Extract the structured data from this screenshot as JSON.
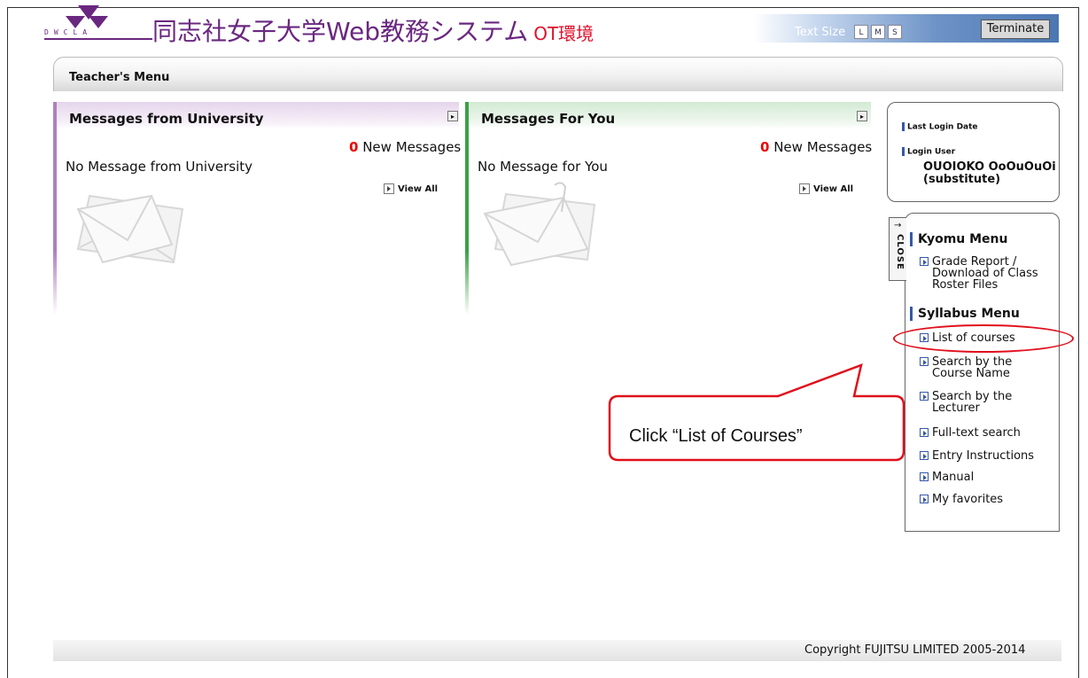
{
  "header": {
    "logo_letters": "DWCLA",
    "site_title": "同志社女子大学Web教務システム",
    "env_label": "OT環境",
    "text_size_label": "Text Size",
    "text_size_options": [
      "L",
      "M",
      "S"
    ],
    "terminate_label": "Terminate"
  },
  "menubar": {
    "label": "Teacher's Menu"
  },
  "panels": [
    {
      "title": "Messages from University",
      "new_count": "0",
      "new_label": " New Messages",
      "empty_text": "No Message from University",
      "view_all": "View All",
      "accent": "#b07fc0"
    },
    {
      "title": "Messages For You",
      "new_count": "0",
      "new_label": " New Messages",
      "empty_text": "No Message for You",
      "view_all": "View All",
      "accent": "#3aa148"
    }
  ],
  "login": {
    "last_login_label": "Last Login Date",
    "login_user_label": "Login User",
    "user_name": "OUOIOKO OoOuOuOi",
    "user_role": "(substitute)"
  },
  "sidebar": {
    "close_label": "CLOSE",
    "close_arrow": "→",
    "sections": [
      {
        "title": "Kyomu Menu",
        "items": [
          "Grade Report / Download of Class Roster Files"
        ]
      },
      {
        "title": "Syllabus Menu",
        "items": [
          "List of courses",
          "Search by the Course Name",
          "Search by the Lecturer",
          "Full-text search",
          "Entry Instructions",
          "Manual",
          "My favorites"
        ]
      }
    ]
  },
  "annotation": {
    "text": "Click “List of Courses”",
    "color": "#e0101c"
  },
  "footer": {
    "copyright": "Copyright FUJITSU LIMITED 2005-2014"
  }
}
